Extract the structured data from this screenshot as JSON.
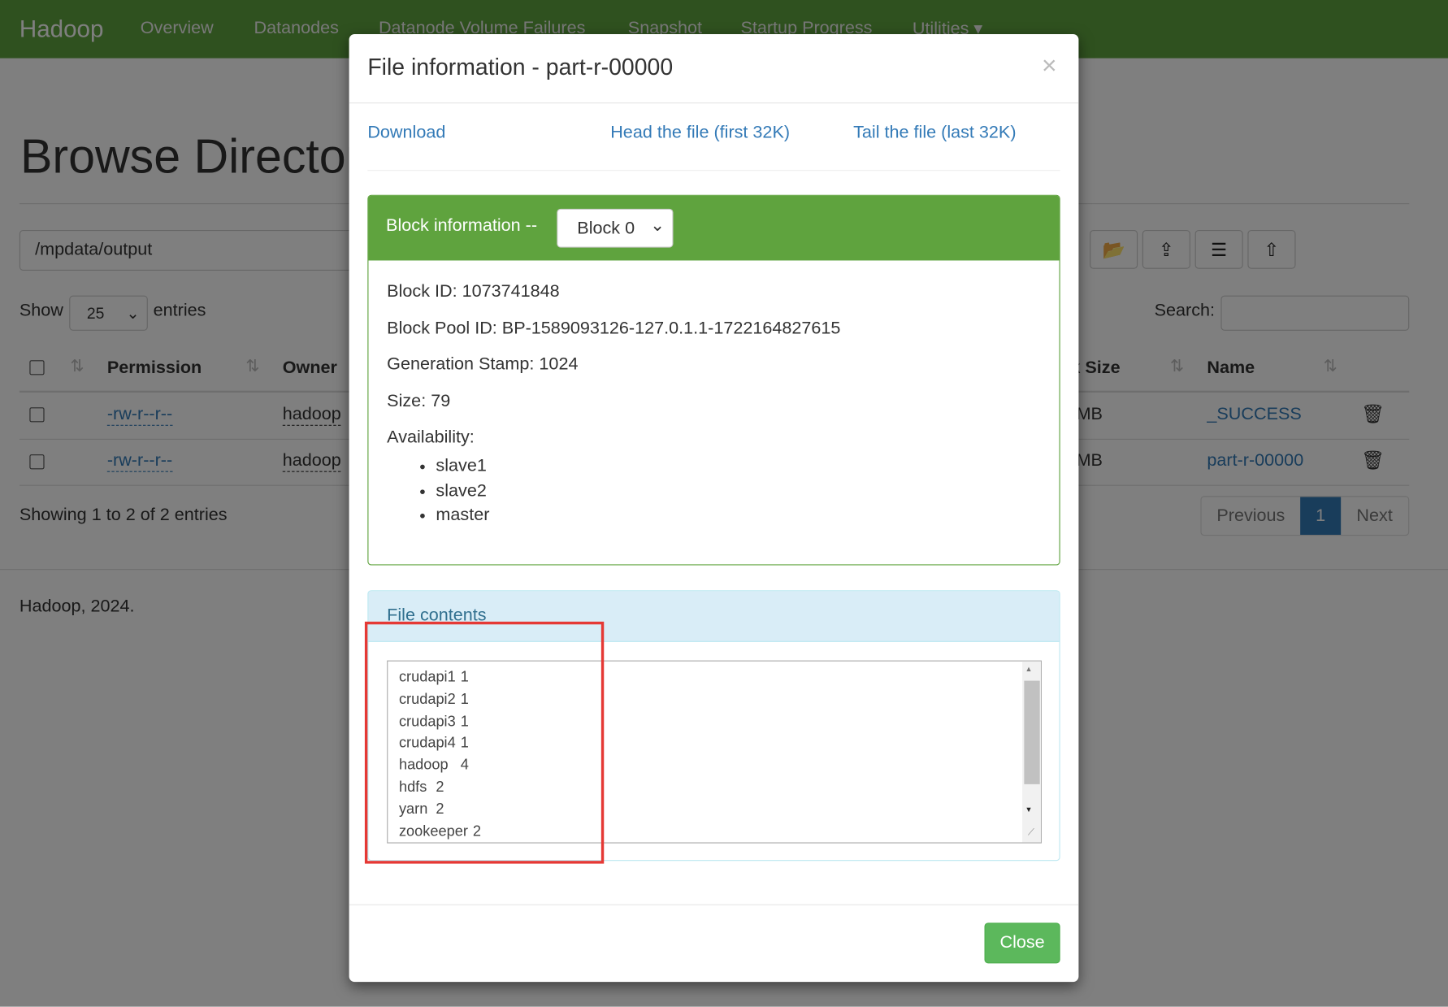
{
  "navbar": {
    "brand": "Hadoop",
    "items": [
      "Overview",
      "Datanodes",
      "Datanode Volume Failures",
      "Snapshot",
      "Startup Progress",
      "Utilities ▾"
    ],
    "color": "#5fa33e"
  },
  "page": {
    "title": "Browse Directory",
    "path": "/mpdata/output",
    "toolbar_icons": [
      "folder-open-icon",
      "cloud-upload-icon",
      "list-icon",
      "folder-upload-icon"
    ],
    "show_label": "Show",
    "page_size": "25",
    "entries_label": "entries",
    "search_label": "Search:",
    "search_value": "",
    "columns": [
      "Permission",
      "Owner",
      "Block Size",
      "Name"
    ],
    "rows": [
      {
        "permission": "-rw-r--r--",
        "owner": "hadoop",
        "block_size": "MB",
        "name": "_SUCCESS"
      },
      {
        "permission": "-rw-r--r--",
        "owner": "hadoop",
        "block_size": "MB",
        "name": "part-r-00000"
      }
    ],
    "info": "Showing 1 to 2 of 2 entries",
    "pagination": {
      "previous": "Previous",
      "current": "1",
      "next": "Next"
    },
    "footer": "Hadoop, 2024."
  },
  "modal": {
    "title": "File information - part-r-00000",
    "close_symbol": "×",
    "links": {
      "download": "Download",
      "head": "Head the file (first 32K)",
      "tail": "Tail the file (last 32K)"
    },
    "block": {
      "label": "Block information --",
      "selected": "Block 0",
      "id": "Block ID: 1073741848",
      "pool": "Block Pool ID: BP-1589093126-127.0.1.1-1722164827615",
      "gen": "Generation Stamp: 1024",
      "size": "Size: 79",
      "availability": "Availability:",
      "nodes": [
        "slave1",
        "slave2",
        "master"
      ]
    },
    "contents": {
      "label": "File contents",
      "text": "crudapi1\t1\ncrudapi2\t1\ncrudapi3\t1\ncrudapi4\t1\nhadoop\t4\nhdfs\t2\nyarn\t2\nzookeeper\t2"
    },
    "close_button": "Close",
    "highlight_color": "#e53935"
  }
}
